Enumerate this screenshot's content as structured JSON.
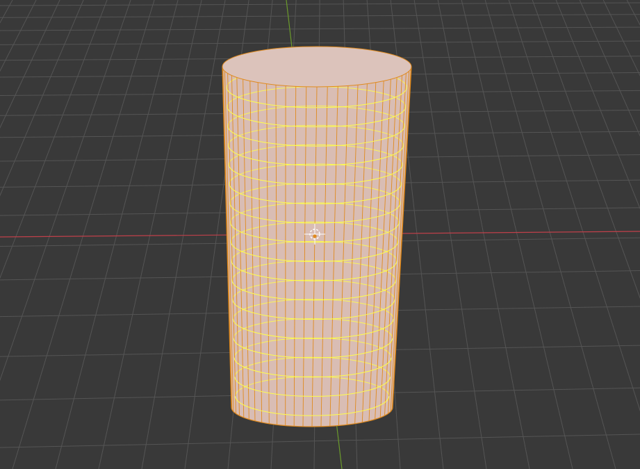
{
  "viewport": {
    "background_color": "#393939",
    "grid_line_color": "#555555",
    "x_axis_color": "#c0404a",
    "y_axis_color": "#6b9a2c",
    "cursor_color": "#ffffff"
  },
  "object": {
    "shape": "cylinder",
    "selected": true,
    "display": "wireframe-on-solid",
    "body_color": "#d9bdb4",
    "cap_color": "#dcc3bb",
    "vertical_edge_color": "#e08a1e",
    "ring_color": "#ffff4a",
    "origin_color": "#e08a1e",
    "vertical_segments": 28,
    "rings": 17
  },
  "cursor": {
    "icon": "3d-cursor-icon"
  }
}
